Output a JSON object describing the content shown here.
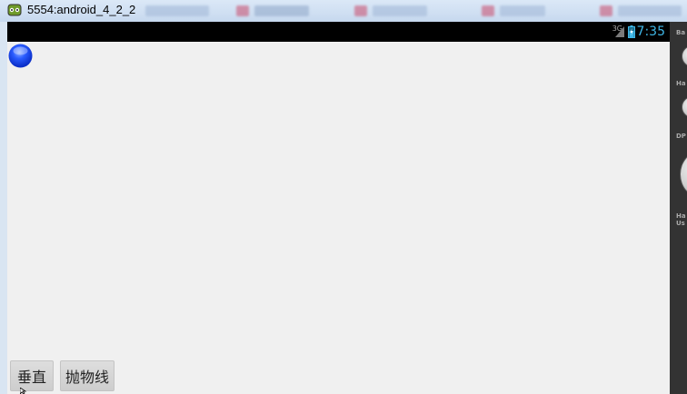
{
  "window": {
    "title": "5554:android_4_2_2"
  },
  "status_bar": {
    "network": "3G",
    "time": "7:35"
  },
  "app": {
    "buttons": {
      "vertical_label": "垂直",
      "parabola_label": "抛物线"
    }
  },
  "side_panel": {
    "labels": [
      "Ba",
      "Ha",
      "DP",
      "Ha",
      "Us"
    ]
  },
  "colors": {
    "status_time": "#3fb7e7",
    "ball": "#1f4fff",
    "screen_bg": "#f0f0f0"
  }
}
